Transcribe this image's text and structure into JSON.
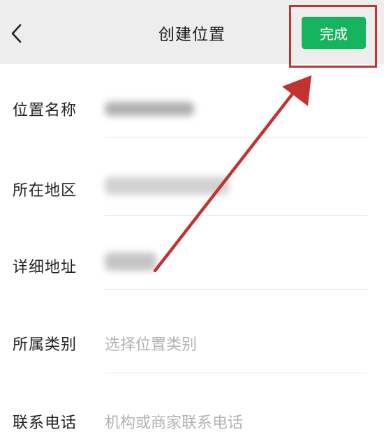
{
  "header": {
    "title": "创建位置",
    "done_label": "完成"
  },
  "form": {
    "rows": [
      {
        "label": "位置名称",
        "value": ""
      },
      {
        "label": "所在地区",
        "value": ""
      },
      {
        "label": "详细地址",
        "value": ""
      },
      {
        "label": "所属类别",
        "placeholder": "选择位置类别"
      },
      {
        "label": "联系电话",
        "placeholder": "机构或商家联系电话"
      }
    ]
  },
  "colors": {
    "header_bg": "#ededed",
    "accent_green": "#16b45e",
    "annotation_red": "#c4322f",
    "placeholder_gray": "#b3b3b3"
  },
  "icons": {
    "back": "chevron-left-icon"
  }
}
